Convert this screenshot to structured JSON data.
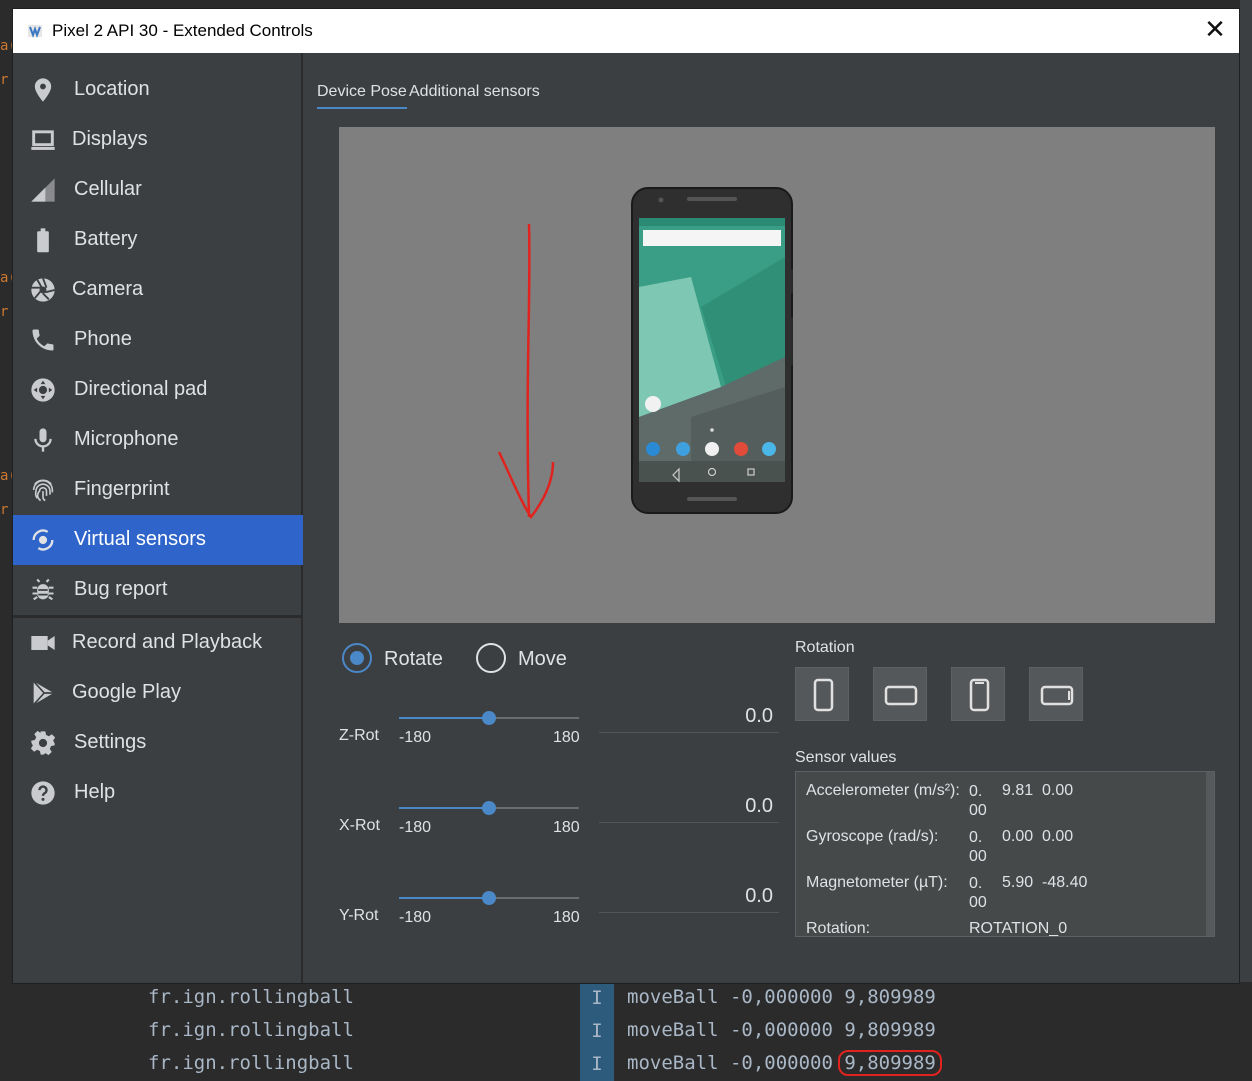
{
  "window": {
    "title": "Pixel 2 API 30 - Extended Controls",
    "close_glyph": "✕"
  },
  "sidebar": {
    "items": [
      {
        "label": "Location",
        "icon": "location-pin-icon"
      },
      {
        "label": "Displays",
        "icon": "display-icon"
      },
      {
        "label": "Cellular",
        "icon": "signal-icon"
      },
      {
        "label": "Battery",
        "icon": "battery-icon"
      },
      {
        "label": "Camera",
        "icon": "camera-shutter-icon"
      },
      {
        "label": "Phone",
        "icon": "phone-icon"
      },
      {
        "label": "Directional pad",
        "icon": "dpad-icon"
      },
      {
        "label": "Microphone",
        "icon": "microphone-icon"
      },
      {
        "label": "Fingerprint",
        "icon": "fingerprint-icon"
      },
      {
        "label": "Virtual sensors",
        "icon": "rotation-sensor-icon",
        "active": true
      },
      {
        "label": "Bug report",
        "icon": "bug-icon"
      },
      {
        "label": "Record and Playback",
        "icon": "video-camera-icon"
      },
      {
        "label": "Google Play",
        "icon": "play-store-icon"
      },
      {
        "label": "Settings",
        "icon": "gear-icon"
      },
      {
        "label": "Help",
        "icon": "help-icon"
      }
    ]
  },
  "tabs": [
    {
      "label": "Device Pose",
      "active": true
    },
    {
      "label": "Additional sensors",
      "active": false
    }
  ],
  "modes": {
    "rotate": "Rotate",
    "move": "Move",
    "selected": "rotate"
  },
  "sliders": [
    {
      "name": "Z-Rot",
      "min": "-180",
      "max": "180",
      "value": "0.0",
      "fraction": 0.5
    },
    {
      "name": "X-Rot",
      "min": "-180",
      "max": "180",
      "value": "0.0",
      "fraction": 0.5
    },
    {
      "name": "Y-Rot",
      "min": "-180",
      "max": "180",
      "value": "0.0",
      "fraction": 0.5
    }
  ],
  "rotation": {
    "label": "Rotation"
  },
  "sensors": {
    "label": "Sensor values",
    "rows": [
      {
        "name": "Accelerometer (m/s²):",
        "v1": "0.00",
        "v2": "9.81",
        "v3": "0.00"
      },
      {
        "name": "Gyroscope (rad/s):",
        "v1": "0.00",
        "v2": "0.00",
        "v3": "0.00"
      },
      {
        "name": "Magnetometer (µT):",
        "v1": "0.00",
        "v2": "5.90",
        "v3": "-48.40"
      },
      {
        "name": "Rotation:",
        "v1": "ROTATION_0",
        "v2": "",
        "v3": ""
      }
    ]
  },
  "logcat": {
    "rows": [
      {
        "tag": "fr.ign.rollingball",
        "level": "I",
        "msg": "moveBall -0,000000 ",
        "value": "9,809989"
      },
      {
        "tag": "fr.ign.rollingball",
        "level": "I",
        "msg": "moveBall -0,000000 ",
        "value": "9,809989"
      },
      {
        "tag": "fr.ign.rollingball",
        "level": "I",
        "msg": "moveBall -0,000000 ",
        "value": "9,809989",
        "circled": true
      }
    ]
  },
  "ide": {
    "gutter_marks": [
      "a(",
      "r",
      "a(",
      "r",
      "a(",
      "r"
    ]
  },
  "colors": {
    "accent": "#2f65ca",
    "slider": "#4a88c7",
    "annotation": "#e0231f",
    "canvas": "#7f7f7f"
  }
}
